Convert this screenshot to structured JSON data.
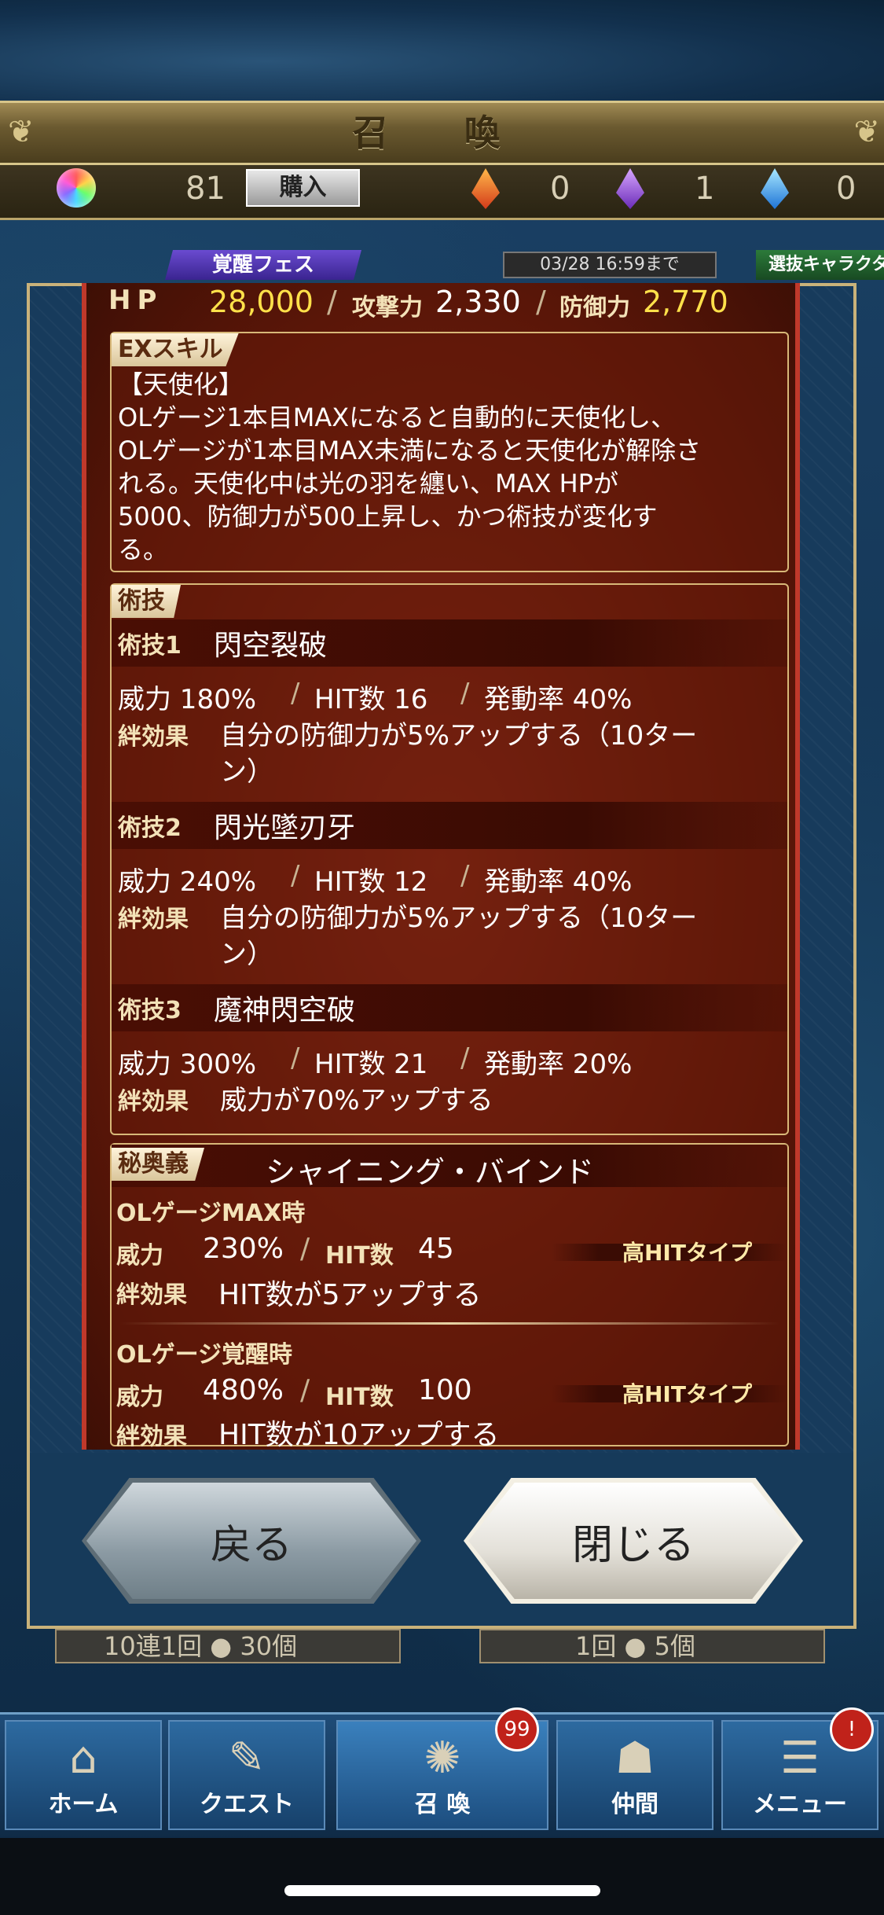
{
  "header": {
    "title": "召 喚"
  },
  "currency": {
    "orb_count": "81",
    "buy_label": "購入",
    "red_count": "0",
    "purple_count": "1",
    "blue_count": "0"
  },
  "behind": {
    "fes_label": "覚醒フェス",
    "deadline": "03/28 16:59まで",
    "select_label": "選抜キャラクタ",
    "pull10": "10連1回 ● 30個",
    "pull1": "1回 ● 5個"
  },
  "stats": {
    "hp_label": "HP",
    "hp_value": "28,000",
    "atk_label": "攻撃力",
    "atk_value": "2,330",
    "def_label": "防御力",
    "def_value": "2,770"
  },
  "ex_skill": {
    "tag": "EXスキル",
    "lines": [
      "【天使化】",
      "OLゲージ1本目MAXになると自動的に天使化し、",
      "OLゲージが1本目MAX未満になると天使化が解除さ",
      "れる。天使化中は光の羽を纏い、MAX HPが",
      "5000、防御力が500上昇し、かつ術技が変化す",
      "る。"
    ]
  },
  "arts": {
    "tag": "術技",
    "items": [
      {
        "label": "術技1",
        "name": "閃空裂破",
        "power": "威力 180%",
        "hits": "HIT数 16",
        "rate": "発動率 40%",
        "bond_label": "絆効果",
        "bond_line1": "自分の防御力が5%アップする（10ター",
        "bond_line2": "ン）"
      },
      {
        "label": "術技2",
        "name": "閃光墜刃牙",
        "power": "威力 240%",
        "hits": "HIT数 12",
        "rate": "発動率 40%",
        "bond_label": "絆効果",
        "bond_line1": "自分の防御力が5%アップする（10ター",
        "bond_line2": "ン）"
      },
      {
        "label": "術技3",
        "name": "魔神閃空破",
        "power": "威力 300%",
        "hits": "HIT数 21",
        "rate": "発動率 20%",
        "bond_label": "絆効果",
        "bond_line1": "威力が70%アップする",
        "bond_line2": ""
      }
    ]
  },
  "ougi": {
    "tag": "秘奥義",
    "name": "シャイニング・バインド",
    "max": {
      "title": "OLゲージMAX時",
      "power_label": "威力",
      "power_value": "230%",
      "hits_label": "HIT数",
      "hits_value": "45",
      "type": "高HITタイプ",
      "bond_label": "絆効果",
      "bond_text": "HIT数が5アップする"
    },
    "awake": {
      "title": "OLゲージ覚醒時",
      "power_label": "威力",
      "power_value": "480%",
      "hits_label": "HIT数",
      "hits_value": "100",
      "type": "高HITタイプ",
      "bond_label": "絆効果",
      "bond_text": "HIT数が10アップする"
    }
  },
  "buttons": {
    "back": "戻る",
    "close": "閉じる"
  },
  "nav": {
    "items": [
      {
        "label": "ホーム",
        "icon": "home-icon"
      },
      {
        "label": "クエスト",
        "icon": "map-icon"
      },
      {
        "label": "召 喚",
        "icon": "summon-icon",
        "badge": "99"
      },
      {
        "label": "仲間",
        "icon": "ally-icon"
      },
      {
        "label": "メニュー",
        "icon": "scroll-icon",
        "badge": "!"
      }
    ]
  }
}
